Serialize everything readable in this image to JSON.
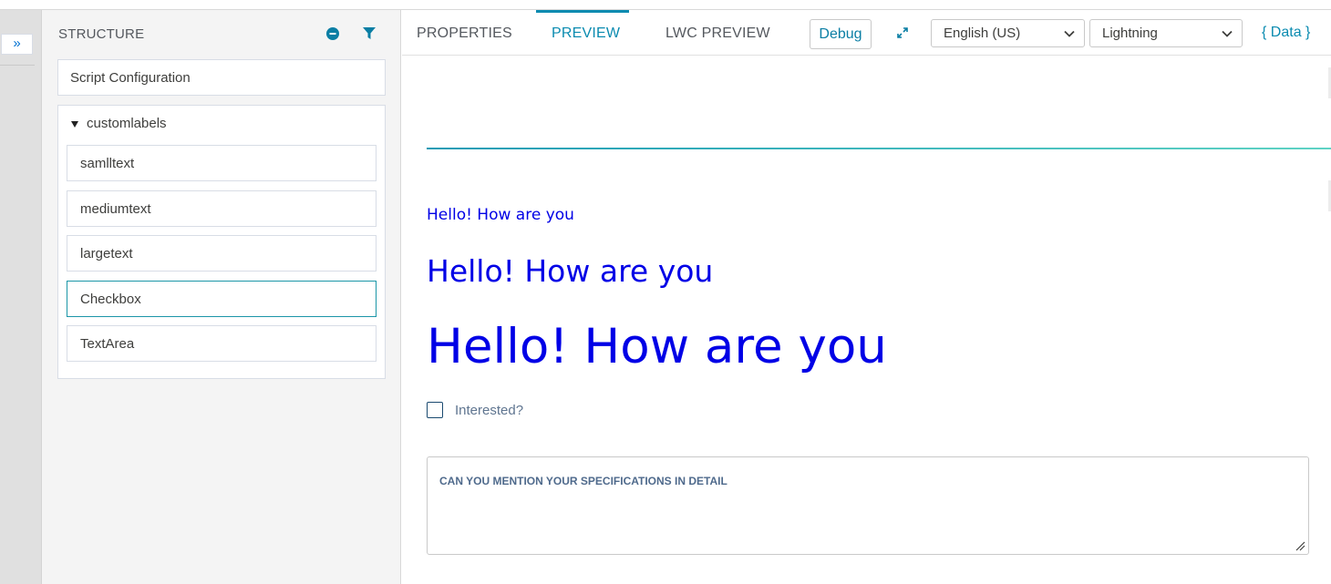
{
  "rail": {
    "expand_label": "»"
  },
  "structure": {
    "title": "STRUCTURE",
    "script_config": "Script Configuration",
    "group_label": "customlabels",
    "items": [
      {
        "label": "samlltext"
      },
      {
        "label": "mediumtext"
      },
      {
        "label": "largetext"
      },
      {
        "label": "Checkbox",
        "selected": true
      },
      {
        "label": "TextArea"
      }
    ]
  },
  "toolbar": {
    "tabs": [
      {
        "label": "PROPERTIES",
        "active": false
      },
      {
        "label": "PREVIEW",
        "active": true
      },
      {
        "label": "LWC PREVIEW",
        "active": false
      }
    ],
    "debug_label": "Debug",
    "language": "English (US)",
    "theme": "Lightning",
    "data_label": "{ Data }"
  },
  "preview": {
    "small_text": "Hello! How are you",
    "medium_text": "Hello! How are you",
    "large_text": "Hello! How are you",
    "checkbox_label": "Interested?",
    "checkbox_checked": false,
    "textarea_label": "CAN YOU MENTION YOUR SPECIFICATIONS IN DETAIL"
  },
  "colors": {
    "accent": "#0a8bb0",
    "preview_text": "#0000e6",
    "selected_border": "#1b96a8"
  },
  "icons": {
    "collapse": "minus-circle-icon",
    "filter": "filter-icon",
    "fullscreen": "expand-arrows-icon",
    "dropdown": "chevron-down-icon",
    "caret": "caret-down-icon",
    "resize": "resize-grip-icon"
  }
}
